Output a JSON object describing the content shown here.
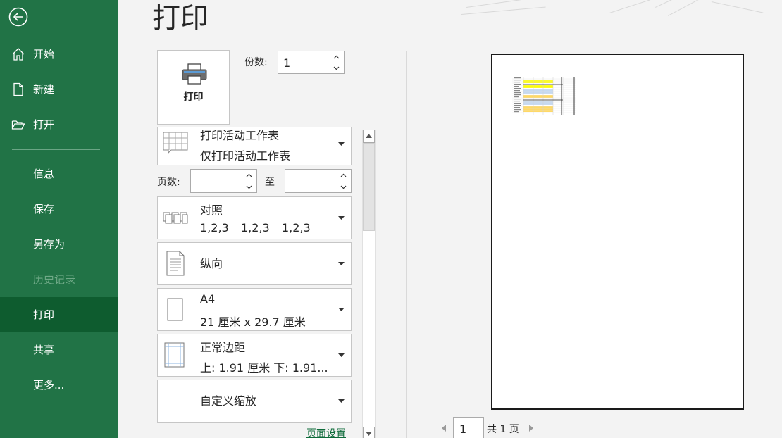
{
  "title": "打印",
  "sidebar": {
    "items": [
      {
        "label": "开始"
      },
      {
        "label": "新建"
      },
      {
        "label": "打开"
      },
      {
        "label": "信息"
      },
      {
        "label": "保存"
      },
      {
        "label": "另存为"
      },
      {
        "label": "历史记录"
      },
      {
        "label": "打印"
      },
      {
        "label": "共享"
      },
      {
        "label": "更多..."
      }
    ]
  },
  "print_button": {
    "label": "打印"
  },
  "copies": {
    "label": "份数:",
    "value": "1"
  },
  "settings": {
    "scope": {
      "line1": "打印活动工作表",
      "line2": "仅打印活动工作表"
    },
    "pages": {
      "label": "页数:",
      "to_label": "至",
      "from_value": "",
      "to_value": ""
    },
    "collate": {
      "line1": "对照",
      "line2a": "1,2,3",
      "line2b": "1,2,3",
      "line2c": "1,2,3"
    },
    "orientation": {
      "line1": "纵向"
    },
    "paper": {
      "line1": "A4",
      "line2": "21 厘米 x 29.7 厘米"
    },
    "margins": {
      "line1": "正常边距",
      "line2": "上: 1.91 厘米 下: 1.91..."
    },
    "scaling": {
      "line1": "自定义缩放"
    }
  },
  "page_setup_link": "页面设置",
  "preview": {
    "current_page": "1",
    "total_label": "共 1 页"
  },
  "colors": {
    "sidebar": "#217346",
    "sidebar_active": "#0e5c2f",
    "link": "#0e6b3a",
    "highlight_yellow": "#ffff00",
    "highlight_blue": "#c5d9f1",
    "highlight_gold": "#ffd966"
  }
}
